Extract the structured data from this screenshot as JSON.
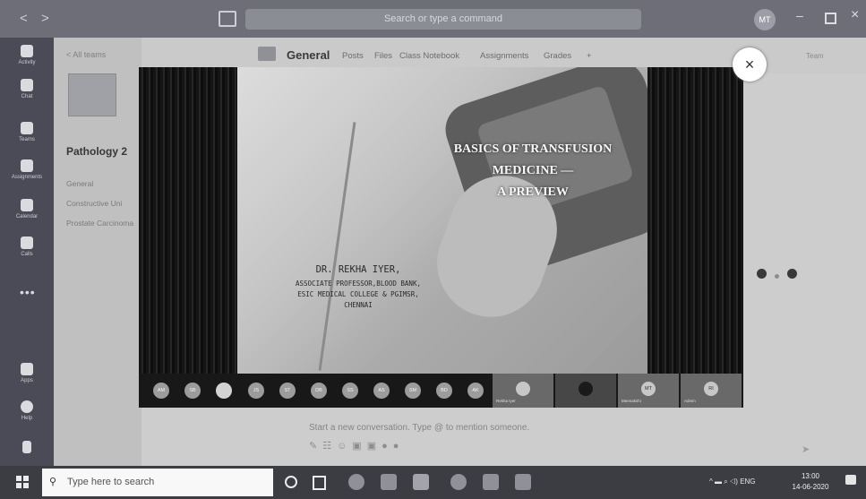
{
  "titlebar": {
    "search_placeholder": "Search or type a command",
    "user_initials": "MT"
  },
  "rail": [
    {
      "label": "Activity",
      "icon": "bell-icon"
    },
    {
      "label": "Chat",
      "icon": "chat-icon"
    },
    {
      "label": "Teams",
      "icon": "teams-icon"
    },
    {
      "label": "Assignments",
      "icon": "assignments-icon"
    },
    {
      "label": "Calendar",
      "icon": "calendar-icon"
    },
    {
      "label": "Calls",
      "icon": "phone-icon"
    },
    {
      "label": "Apps",
      "icon": "apps-icon"
    },
    {
      "label": "Help",
      "icon": "help-icon"
    }
  ],
  "sidebar": {
    "back_label": "< All teams",
    "team_name": "Pathology 2",
    "channels": [
      "General",
      "Constructive Uni",
      "Prostate Carcinoma"
    ]
  },
  "channel_header": {
    "title": "General",
    "tabs": [
      "Posts",
      "Files",
      "Class Notebook",
      "Assignments",
      "Grades",
      "+"
    ],
    "right_label": "Team"
  },
  "slide": {
    "title_lines": [
      "BASICS OF TRANSFUSION",
      "MEDICINE —",
      "A PREVIEW"
    ],
    "presenter_name": "DR. REKHA IYER,",
    "presenter_lines": [
      "ASSOCIATE PROFESSOR,BLOOD BANK,",
      "ESIC MEDICAL COLLEGE & PGIMSR,",
      "CHENNAI"
    ]
  },
  "participants": [
    "AM",
    "SB",
    "",
    "JS",
    "ST",
    "DB",
    "SS",
    "AS",
    "SM",
    "BD",
    "AK"
  ],
  "video_tiles": [
    {
      "initials": "",
      "name": "Rekha Iyer"
    },
    {
      "initials": "",
      "name": ""
    },
    {
      "initials": "MT",
      "name": "Meenakshi"
    },
    {
      "initials": "RI",
      "name": "Admin"
    }
  ],
  "compose": {
    "placeholder": "Start a new conversation. Type @ to mention someone."
  },
  "taskbar": {
    "search_placeholder": "Type here to search",
    "tray_text": "^ ▬ ⌕ ◁) ENG",
    "time": "13:00",
    "date": "14-06-2020"
  }
}
